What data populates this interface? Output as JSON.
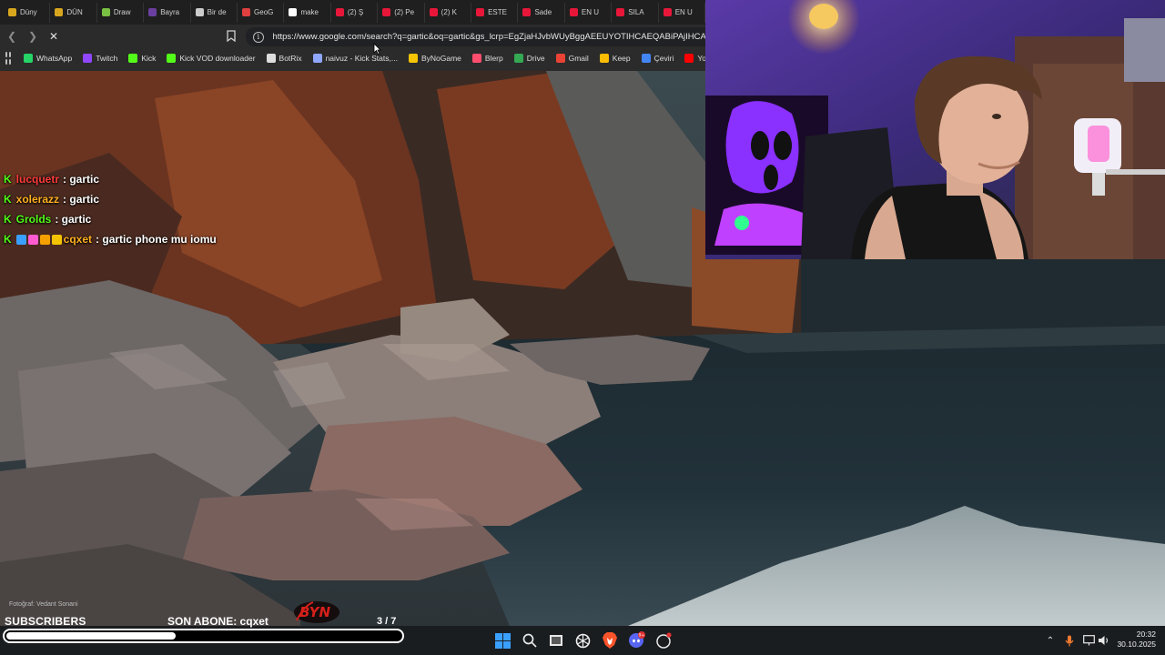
{
  "browser": {
    "tabs": [
      {
        "label": "Düny",
        "color": "#d9a71e"
      },
      {
        "label": "DÜN",
        "color": "#d9a71e"
      },
      {
        "label": "Draw",
        "color": "#7ac043"
      },
      {
        "label": "Bayra",
        "color": "#6b3fa0"
      },
      {
        "label": "Bir de",
        "color": "#cccccc"
      },
      {
        "label": "GeoG",
        "color": "#e04040"
      },
      {
        "label": "make",
        "color": "#ffffff"
      },
      {
        "label": "(2) Ş",
        "color": "#e8173a"
      },
      {
        "label": "(2) Pe",
        "color": "#e8173a"
      },
      {
        "label": "(2) K",
        "color": "#e8173a"
      },
      {
        "label": "ESTE",
        "color": "#e8173a"
      },
      {
        "label": "Sade",
        "color": "#e8173a"
      },
      {
        "label": "EN U",
        "color": "#e8173a"
      },
      {
        "label": "SILA",
        "color": "#e8173a"
      },
      {
        "label": "EN U",
        "color": "#e8173a"
      }
    ],
    "url": "https://www.google.com/search?q=gartic&oq=gartic&gs_lcrp=EgZjaHJvbWUyBggAEEUYOTIHCAEQABiPAjIHCAIQAB",
    "bookmarks": [
      {
        "label": "WhatsApp",
        "icon": "whatsapp-icon",
        "color": "#25d366"
      },
      {
        "label": "Twitch",
        "icon": "twitch-icon",
        "color": "#9146ff"
      },
      {
        "label": "Kick",
        "icon": "kick-icon",
        "color": "#53fc18"
      },
      {
        "label": "Kick VOD downloader",
        "icon": "kick-icon",
        "color": "#53fc18"
      },
      {
        "label": "BotRix",
        "icon": "botrix-icon",
        "color": "#dddddd"
      },
      {
        "label": "naivuz - Kick Stats,...",
        "icon": "stats-icon",
        "color": "#8fa7ff"
      },
      {
        "label": "ByNoGame",
        "icon": "bynogame-icon",
        "color": "#f5c400"
      },
      {
        "label": "Blerp",
        "icon": "blerp-icon",
        "color": "#ff4d6d"
      },
      {
        "label": "Drive",
        "icon": "drive-icon",
        "color": "#34a853"
      },
      {
        "label": "Gmail",
        "icon": "gmail-icon",
        "color": "#ea4335"
      },
      {
        "label": "Keep",
        "icon": "keep-icon",
        "color": "#fbbc04"
      },
      {
        "label": "Çeviri",
        "icon": "translate-icon",
        "color": "#4285f4"
      },
      {
        "label": "YouTube",
        "icon": "youtube-icon",
        "color": "#ff0000"
      }
    ]
  },
  "chat": [
    {
      "user": "lucquetr",
      "text": ": gartic",
      "user_color": "#ff3b3b",
      "badges": [
        "kick-icon"
      ]
    },
    {
      "user": "xolerazz",
      "text": ": gartic",
      "user_color": "#ffb020",
      "badges": [
        "kick-icon"
      ]
    },
    {
      "user": "Grolds",
      "text": ": gartic",
      "user_color": "#53fc18",
      "badges": [
        "kick-icon"
      ]
    },
    {
      "user": "cqxet",
      "text": ": gartic phone mu iomu",
      "user_color": "#ffb020",
      "badges": [
        "kick-icon",
        "verified-icon",
        "gift-icon",
        "number-one-icon",
        "crown-icon"
      ]
    }
  ],
  "overlay": {
    "photo_credit": "Fotoğraf: Vedant Sonani",
    "subscribers_label": "SUBSCRIBERS",
    "last_sub": "SON ABONE: cqxet",
    "sub_count": "3 / 7",
    "sub_progress": 0.43,
    "logo_text": "BYN"
  },
  "taskbar": {
    "time": "20:32",
    "date": "30.10.2025",
    "discord_badge": "9+"
  },
  "colors": {
    "kick_green": "#53fc18",
    "taskbar_bg": "#1c1f22"
  }
}
